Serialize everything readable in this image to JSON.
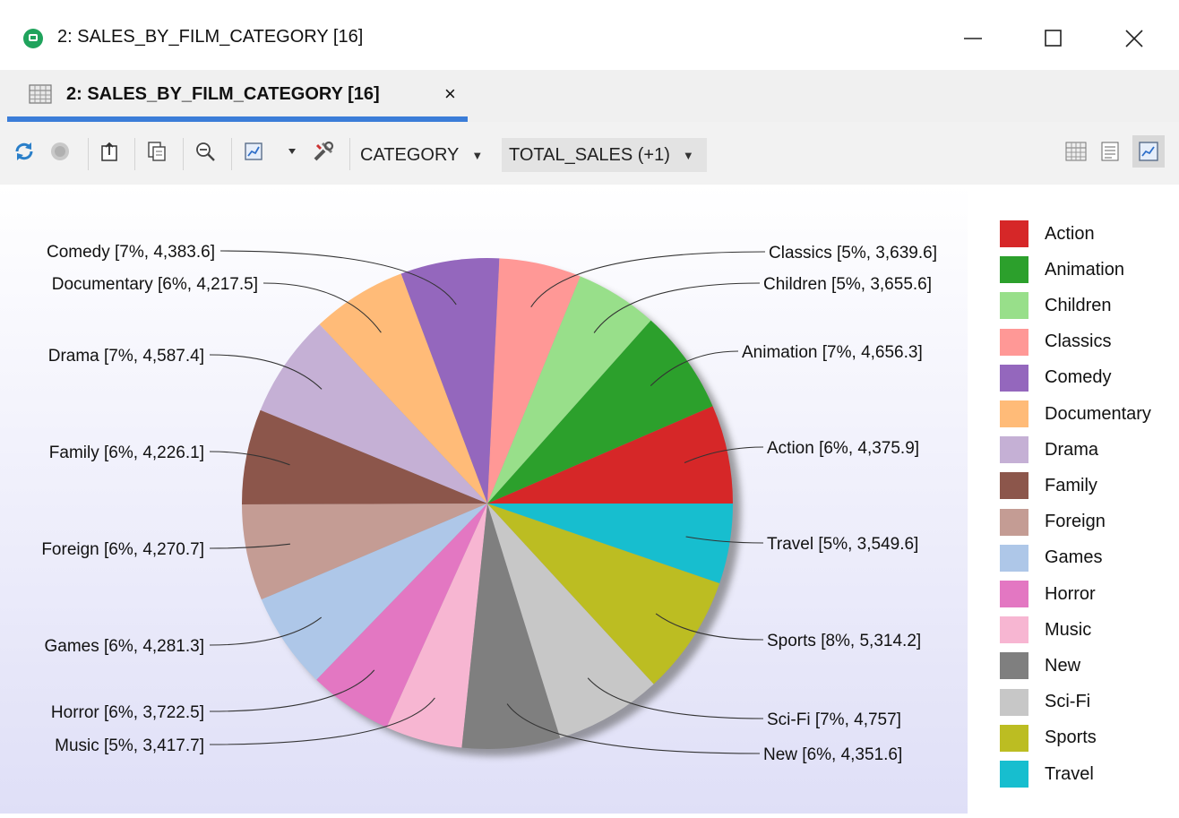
{
  "window": {
    "title": "2: SALES_BY_FILM_CATEGORY [16]"
  },
  "tab": {
    "label": "2: SALES_BY_FILM_CATEGORY [16]",
    "close_glyph": "×"
  },
  "toolbar": {
    "icons": [
      "refresh-icon",
      "stop-icon",
      "export-icon",
      "copy-icon",
      "zoom-out-icon",
      "chart-icon",
      "dropdown-icon",
      "settings-icon"
    ],
    "category_combo": "CATEGORY",
    "value_combo": "TOTAL_SALES (+1)",
    "view_icons": [
      "grid-view-icon",
      "text-view-icon",
      "chart-view-icon"
    ]
  },
  "chart_data": {
    "type": "pie",
    "slices": [
      {
        "name": "Action",
        "value": 4375.9,
        "pct": "6%",
        "label": "Action [6%, 4,375.9]",
        "color": "#d62728"
      },
      {
        "name": "Animation",
        "value": 4656.3,
        "pct": "7%",
        "label": "Animation [7%, 4,656.3]",
        "color": "#2ca02c"
      },
      {
        "name": "Children",
        "value": 3655.6,
        "pct": "5%",
        "label": "Children [5%, 3,655.6]",
        "color": "#98df8a"
      },
      {
        "name": "Classics",
        "value": 3639.6,
        "pct": "5%",
        "label": "Classics [5%, 3,639.6]",
        "color": "#ff9896"
      },
      {
        "name": "Comedy",
        "value": 4383.6,
        "pct": "7%",
        "label": "Comedy [7%, 4,383.6]",
        "color": "#9467bd"
      },
      {
        "name": "Documentary",
        "value": 4217.5,
        "pct": "6%",
        "label": "Documentary [6%, 4,217.5]",
        "color": "#ffbb78"
      },
      {
        "name": "Drama",
        "value": 4587.4,
        "pct": "7%",
        "label": "Drama [7%, 4,587.4]",
        "color": "#c5b0d5"
      },
      {
        "name": "Family",
        "value": 4226.1,
        "pct": "6%",
        "label": "Family [6%, 4,226.1]",
        "color": "#8c564b"
      },
      {
        "name": "Foreign",
        "value": 4270.7,
        "pct": "6%",
        "label": "Foreign [6%, 4,270.7]",
        "color": "#c49c94"
      },
      {
        "name": "Games",
        "value": 4281.3,
        "pct": "6%",
        "label": "Games [6%, 4,281.3]",
        "color": "#aec7e8"
      },
      {
        "name": "Horror",
        "value": 3722.5,
        "pct": "6%",
        "label": "Horror [6%, 3,722.5]",
        "color": "#e377c2"
      },
      {
        "name": "Music",
        "value": 3417.7,
        "pct": "5%",
        "label": "Music [5%, 3,417.7]",
        "color": "#f7b6d2"
      },
      {
        "name": "New",
        "value": 4351.6,
        "pct": "6%",
        "label": "New [6%, 4,351.6]",
        "color": "#7f7f7f"
      },
      {
        "name": "Sci-Fi",
        "value": 4757,
        "pct": "7%",
        "label": "Sci-Fi [7%, 4,757]",
        "color": "#c7c7c7"
      },
      {
        "name": "Sports",
        "value": 5314.2,
        "pct": "8%",
        "label": "Sports [8%, 5,314.2]",
        "color": "#bcbd22"
      },
      {
        "name": "Travel",
        "value": 3549.6,
        "pct": "5%",
        "label": "Travel [5%, 3,549.6]",
        "color": "#17becf"
      }
    ],
    "legend_position": "right"
  }
}
